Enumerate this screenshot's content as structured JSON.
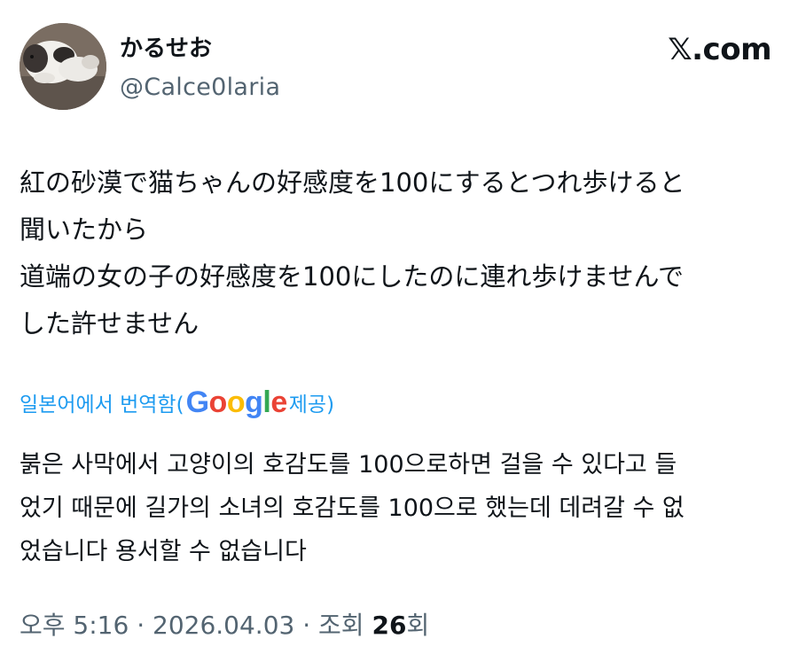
{
  "author": {
    "display_name": "かるせお",
    "handle": "@Calce0laria"
  },
  "brand": "𝕏.com",
  "tweet": {
    "lines": [
      "紅の砂漠で猫ちゃんの好感度を100にするとつれ歩けると",
      "聞いたから",
      "道端の女の子の好感度を100にしたのに連れ歩けませんで",
      "した許せません"
    ]
  },
  "translation": {
    "prefix": "일본어에서 번역함(",
    "google_letters": [
      "G",
      "o",
      "o",
      "g",
      "l",
      "e"
    ],
    "suffix": " 제공)",
    "lines": [
      "붉은 사막에서 고양이의 호감도를 100으로하면 걸을 수 있다고 들",
      "었기 때문에 길가의 소녀의 호감도를 100으로 했는데 데려갈 수 없",
      "었습니다 용서할 수 없습니다"
    ]
  },
  "meta": {
    "time": "오후 5:16",
    "separator": " · ",
    "date": "2026.04.03",
    "views_label": "조회 ",
    "views_count": "26",
    "views_suffix": "회"
  },
  "colors": {
    "link": "#1d9bf0",
    "secondary_text": "#536471",
    "primary_text": "#0f1419",
    "google_blue": "#4285f4",
    "google_red": "#ea4335",
    "google_yellow": "#fbbc05",
    "google_green": "#34a853"
  },
  "icons": {
    "avatar": "cat-photo-avatar"
  }
}
